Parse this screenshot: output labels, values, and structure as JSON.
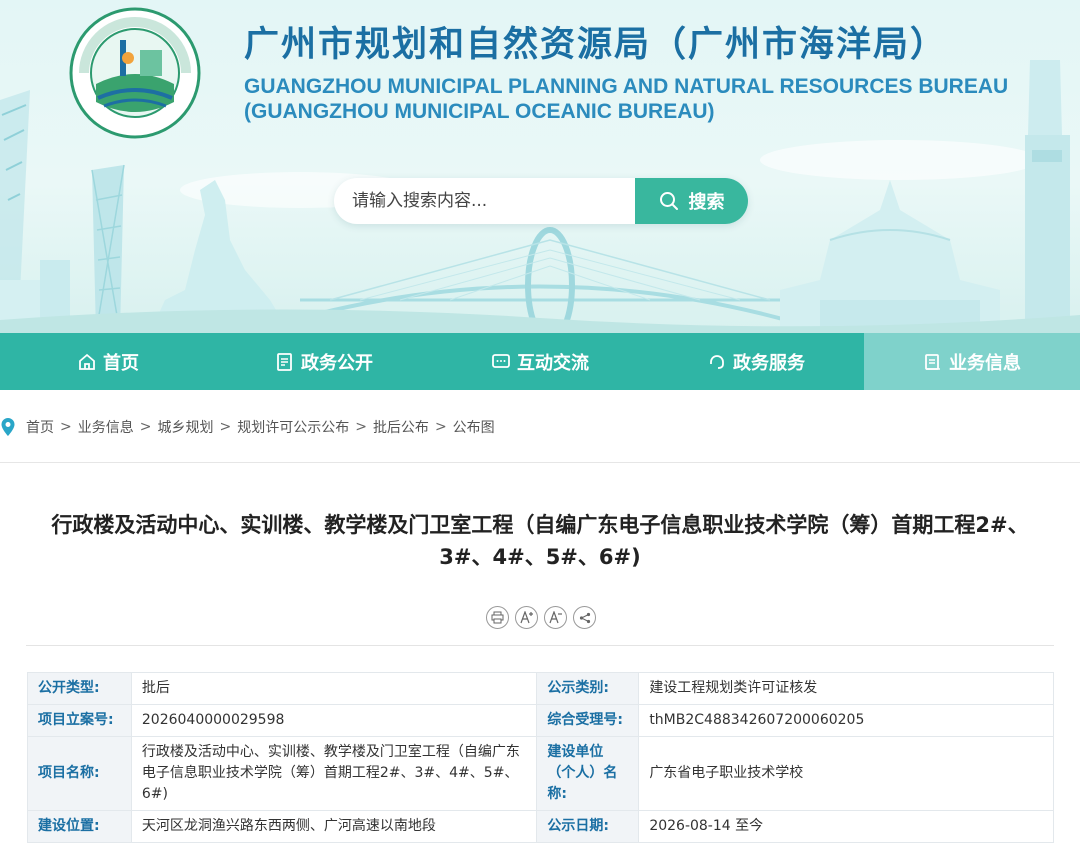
{
  "header": {
    "logo_text": "广州市规划和自然资源局 GUANGZHOU MUNICIPAL PLANNING AND NATURAL RESOURCES BUREAU",
    "title_cn": "广州市规划和自然资源局（广州市海洋局）",
    "title_en_line1": "GUANGZHOU MUNICIPAL PLANNING AND NATURAL RESOURCES BUREAU",
    "title_en_line2": "(GUANGZHOU MUNICIPAL OCEANIC BUREAU)"
  },
  "search": {
    "placeholder": "请输入搜索内容...",
    "button_label": "搜索",
    "icon": "search-icon"
  },
  "nav": {
    "items": [
      {
        "label": "首页",
        "icon": "home-icon"
      },
      {
        "label": "政务公开",
        "icon": "document-icon"
      },
      {
        "label": "互动交流",
        "icon": "chat-icon"
      },
      {
        "label": "政务服务",
        "icon": "headset-icon"
      },
      {
        "label": "业务信息",
        "icon": "briefcase-icon",
        "active": true
      }
    ]
  },
  "breadcrumb": {
    "items": [
      "首页",
      "业务信息",
      "城乡规划",
      "规划许可公示公布",
      "批后公布",
      "公布图"
    ],
    "separator": ">"
  },
  "article": {
    "title": "行政楼及活动中心、实训楼、教学楼及门卫室工程（自编广东电子信息职业技术学院（筹）首期工程2#、3#、4#、5#、6#)",
    "tools": [
      {
        "name": "print-icon",
        "glyph": "⎙"
      },
      {
        "name": "font-increase-icon",
        "glyph": "A+"
      },
      {
        "name": "font-decrease-icon",
        "glyph": "A-"
      },
      {
        "name": "share-icon",
        "glyph": "<"
      }
    ]
  },
  "info_table": {
    "rows": [
      {
        "k1": "公开类型:",
        "v1": "批后",
        "k2": "公示类别:",
        "v2": "建设工程规划类许可证核发"
      },
      {
        "k1": "项目立案号:",
        "v1": "2026040000029598",
        "k2": "综合受理号:",
        "v2": "thMB2C488342607200060205"
      },
      {
        "k1": "项目名称:",
        "v1": "行政楼及活动中心、实训楼、教学楼及门卫室工程（自编广东电子信息职业技术学院（筹）首期工程2#、3#、4#、5#、6#)",
        "k2": "建设单位（个人）名称:",
        "v2": "广东省电子职业技术学校"
      },
      {
        "k1": "建设位置:",
        "v1": "天河区龙洞渔兴路东西两侧、广河高速以南地段",
        "k2": "公示日期:",
        "v2": "2026-08-14 至今"
      }
    ]
  },
  "colors": {
    "primary": "#2fb5a5",
    "nav_active": "#7fd2cb",
    "title_blue": "#1b6fa3",
    "search_button": "#39b79e"
  }
}
